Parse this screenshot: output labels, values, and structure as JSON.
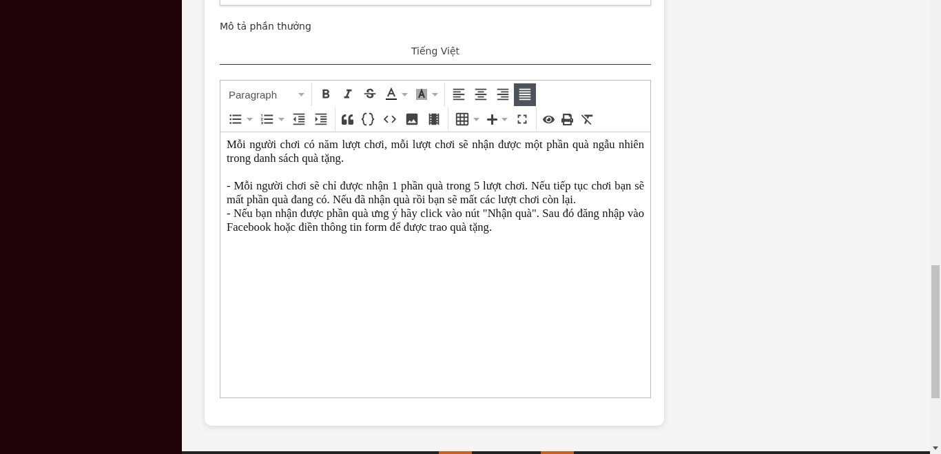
{
  "section_label": "Mô tả phần thưởng",
  "tabs": [
    {
      "label": "Tiếng Việt",
      "selected": true
    }
  ],
  "editor": {
    "format_select": "Paragraph",
    "toolbar_rows": [
      [
        [
          {
            "kind": "bold",
            "dropdown": false,
            "selected": false
          },
          {
            "kind": "italic",
            "dropdown": false,
            "selected": false
          },
          {
            "kind": "strike",
            "dropdown": false,
            "selected": false
          },
          {
            "kind": "font-color",
            "dropdown": true,
            "selected": false
          },
          {
            "kind": "back-color",
            "dropdown": true,
            "selected": false
          }
        ],
        [
          {
            "kind": "align-left",
            "dropdown": false,
            "selected": false
          },
          {
            "kind": "align-center",
            "dropdown": false,
            "selected": false
          },
          {
            "kind": "align-right",
            "dropdown": false,
            "selected": false
          },
          {
            "kind": "align-justify",
            "dropdown": false,
            "selected": true
          }
        ]
      ],
      [
        [
          {
            "kind": "bullet-list",
            "dropdown": true,
            "selected": false
          },
          {
            "kind": "numbered-list",
            "dropdown": true,
            "selected": false
          },
          {
            "kind": "outdent",
            "dropdown": false,
            "selected": false
          },
          {
            "kind": "indent",
            "dropdown": false,
            "selected": false
          }
        ],
        [
          {
            "kind": "quote",
            "dropdown": false,
            "selected": false
          },
          {
            "kind": "code-block",
            "dropdown": false,
            "selected": false
          },
          {
            "kind": "code",
            "dropdown": false,
            "selected": false
          },
          {
            "kind": "image",
            "dropdown": false,
            "selected": false
          },
          {
            "kind": "video",
            "dropdown": false,
            "selected": false
          }
        ],
        [
          {
            "kind": "table",
            "dropdown": true,
            "selected": false
          },
          {
            "kind": "insert",
            "dropdown": true,
            "selected": false
          },
          {
            "kind": "fullscreen",
            "dropdown": false,
            "selected": false
          }
        ],
        [
          {
            "kind": "preview",
            "dropdown": false,
            "selected": false
          },
          {
            "kind": "print",
            "dropdown": false,
            "selected": false
          },
          {
            "kind": "clear-format",
            "dropdown": false,
            "selected": false
          }
        ]
      ]
    ],
    "blocks": [
      [
        "Mỗi người chơi có năm lượt chơi, mỗi lượt chơi sẽ nhận được một phần quà ngẫu nhiên trong danh sách quà tặng."
      ],
      [
        "- Mỗi người chơi sẽ chỉ được nhận 1 phần quà trong 5 lượt chơi. Nếu tiếp tục chơi bạn sẽ mất phần quà đang có. Nếu đã nhận quà rồi bạn sẽ mất các lượt chơi còn lại.",
        "- Nếu bạn nhận được phần quà ưng ý hãy click vào nút \"Nhận quà\". Sau đó đăng nhập vào Facebook hoặc điền thông tin form để được trao quà tặng."
      ]
    ]
  }
}
